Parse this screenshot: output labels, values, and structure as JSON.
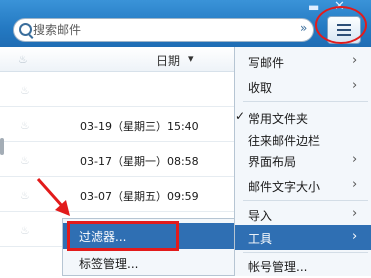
{
  "window": {
    "minimize_glyph": "▬",
    "close_glyph": "✕"
  },
  "search": {
    "placeholder": "搜索邮件",
    "value": ""
  },
  "toolbar": {
    "menu_icon": "list-menu-icon"
  },
  "columns": {
    "date_label": "日期",
    "sort_glyph": "▾"
  },
  "messages": [
    {
      "date": ""
    },
    {
      "date": "03-19（星期三）15:40"
    },
    {
      "date": "03-17（星期一）08:58"
    },
    {
      "date": "03-07（星期五）09:59"
    },
    {
      "date": ""
    }
  ],
  "main_menu": {
    "items": [
      {
        "label": "写邮件",
        "has_submenu": true
      },
      {
        "label": "收取",
        "has_submenu": true
      },
      {
        "label": "常用文件夹",
        "checked": true
      },
      {
        "label": "往来邮件边栏"
      },
      {
        "label": "界面布局",
        "has_submenu": true
      },
      {
        "label": "邮件文字大小",
        "has_submenu": true
      },
      {
        "label": "导入",
        "has_submenu": true
      },
      {
        "label": "工具",
        "has_submenu": true,
        "active": true
      },
      {
        "label": "帐号管理..."
      }
    ],
    "check_glyph": "✓",
    "arrow_glyph": "›"
  },
  "tools_submenu": {
    "items": [
      {
        "label": "过滤器...",
        "active": true
      },
      {
        "label": "标签管理..."
      }
    ]
  },
  "annotation_colors": {
    "highlight": "#e21b1b",
    "menu_active": "#2f6fb3",
    "topbar": "#2479c2"
  }
}
